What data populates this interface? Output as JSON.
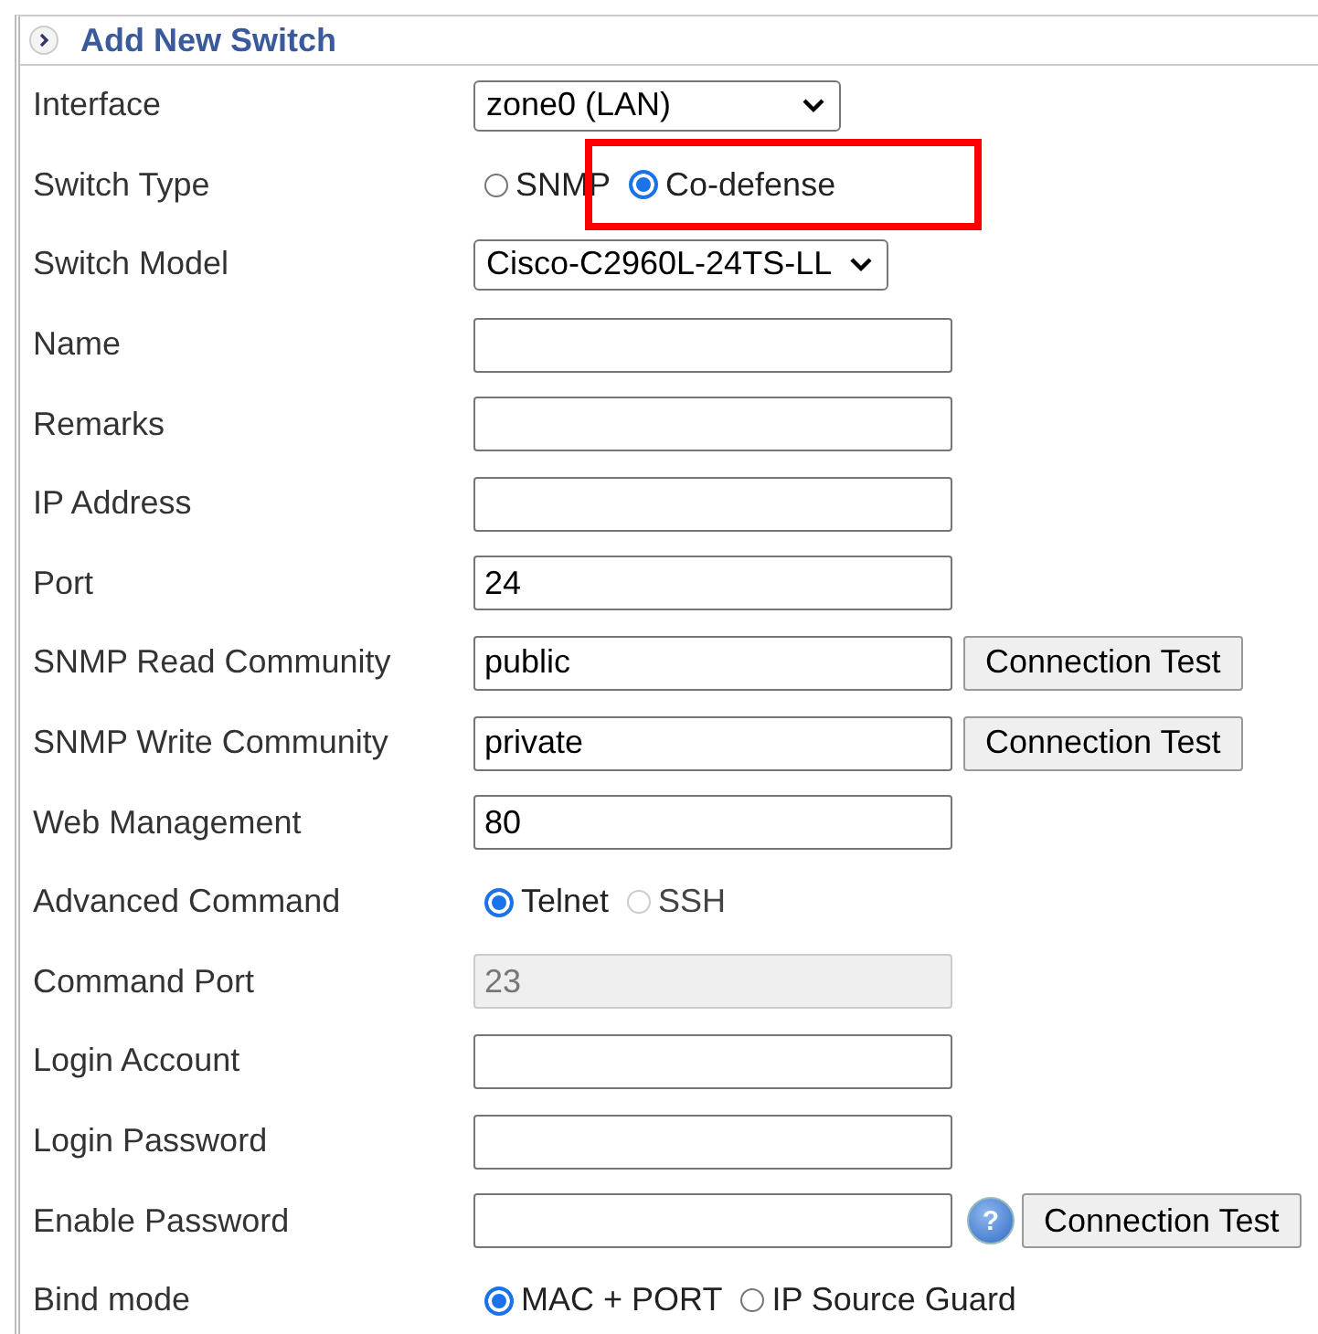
{
  "panel": {
    "title": "Add New Switch"
  },
  "rows": [
    {
      "label": "Interface",
      "kind": "select",
      "value": "zone0 (LAN)"
    },
    {
      "label": "Switch Type",
      "kind": "radio",
      "options": [
        {
          "label": "SNMP",
          "selected": false,
          "disabled": false,
          "highlighted": false
        },
        {
          "label": "Co-defense",
          "selected": true,
          "disabled": false,
          "highlighted": true
        }
      ]
    },
    {
      "label": "Switch Model",
      "kind": "select",
      "value": "Cisco-C2960L-24TS-LL"
    },
    {
      "label": "Name",
      "kind": "input",
      "value": "",
      "disabled": false
    },
    {
      "label": "Remarks",
      "kind": "input",
      "value": "",
      "disabled": false
    },
    {
      "label": "IP Address",
      "kind": "input",
      "value": "",
      "disabled": false
    },
    {
      "label": "Port",
      "kind": "input",
      "value": "24",
      "disabled": false
    },
    {
      "label": "SNMP Read Community",
      "kind": "input",
      "value": "public",
      "disabled": false,
      "button": "Connection Test"
    },
    {
      "label": "SNMP Write Community",
      "kind": "input",
      "value": "private",
      "disabled": false,
      "button": "Connection Test"
    },
    {
      "label": "Web Management",
      "kind": "input",
      "value": "80",
      "disabled": false
    },
    {
      "label": "Advanced Command",
      "kind": "radio",
      "options": [
        {
          "label": "Telnet",
          "selected": true,
          "disabled": false,
          "highlighted": false
        },
        {
          "label": "SSH",
          "selected": false,
          "disabled": true,
          "highlighted": false
        }
      ]
    },
    {
      "label": "Command Port",
      "kind": "input",
      "value": "23",
      "disabled": true
    },
    {
      "label": "Login Account",
      "kind": "input",
      "value": "",
      "disabled": false
    },
    {
      "label": "Login Password",
      "kind": "input",
      "value": "",
      "disabled": false
    },
    {
      "label": "Enable Password",
      "kind": "input",
      "value": "",
      "disabled": false,
      "help": "?",
      "button": "Connection Test"
    },
    {
      "label": "Bind mode",
      "kind": "radio",
      "options": [
        {
          "label": "MAC + PORT",
          "selected": true,
          "disabled": false,
          "highlighted": false
        },
        {
          "label": "IP Source Guard",
          "selected": false,
          "disabled": false,
          "highlighted": false
        }
      ]
    }
  ]
}
